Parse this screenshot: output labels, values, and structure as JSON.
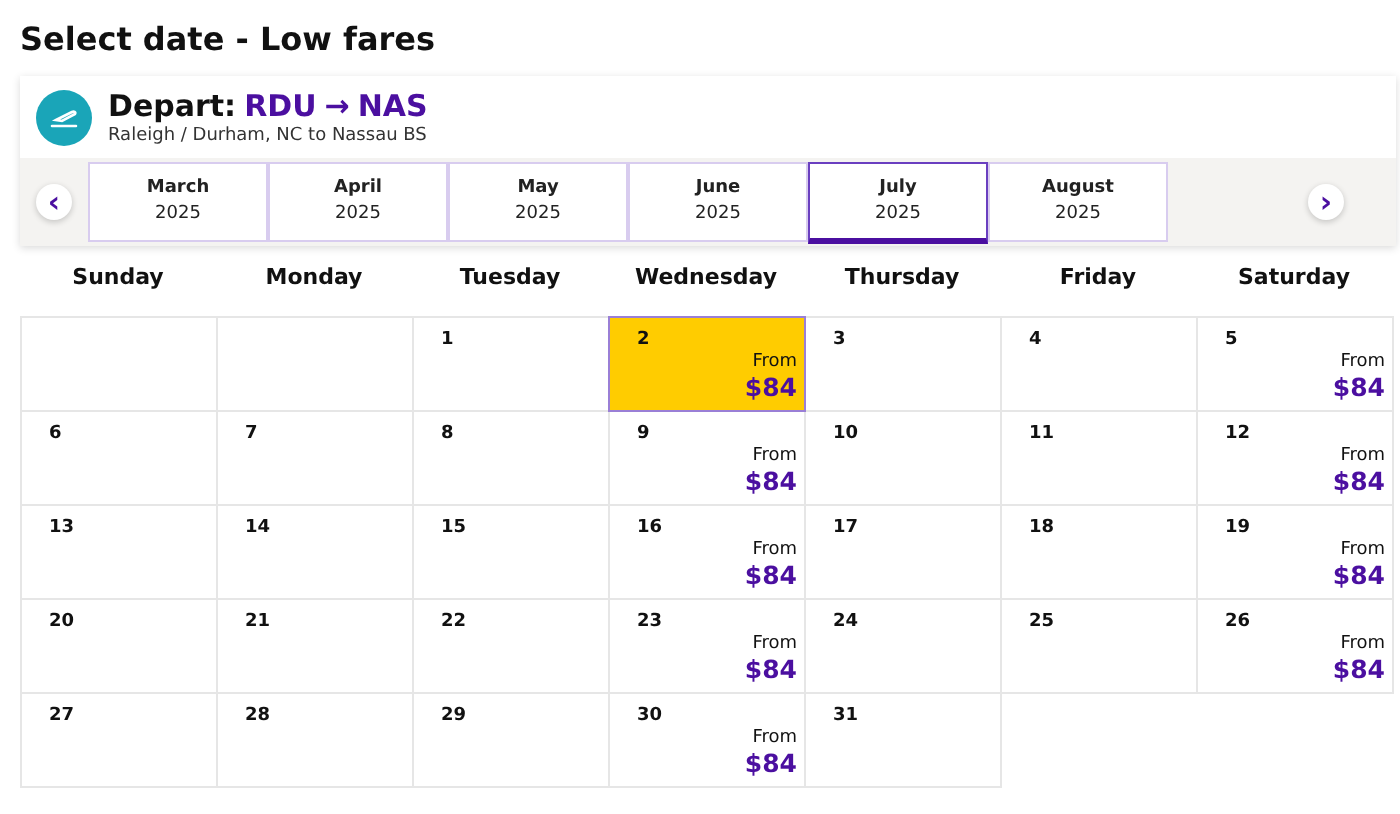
{
  "title": "Select date - Low fares",
  "route": {
    "label": "Depart:",
    "origin": "RDU",
    "arrow": "→",
    "destination": "NAS",
    "subtitle": "Raleigh / Durham, NC to Nassau BS"
  },
  "months": [
    {
      "month": "March",
      "year": "2025",
      "selected": false
    },
    {
      "month": "April",
      "year": "2025",
      "selected": false
    },
    {
      "month": "May",
      "year": "2025",
      "selected": false
    },
    {
      "month": "June",
      "year": "2025",
      "selected": false
    },
    {
      "month": "July",
      "year": "2025",
      "selected": true
    },
    {
      "month": "August",
      "year": "2025",
      "selected": false
    }
  ],
  "prev_button": "‹",
  "next_button": "›",
  "weekdays": [
    "Sunday",
    "Monday",
    "Tuesday",
    "Wednesday",
    "Thursday",
    "Friday",
    "Saturday"
  ],
  "weeks": [
    {
      "cells": [
        {
          "kind": "blank"
        },
        {
          "kind": "blank"
        },
        {
          "kind": "day",
          "day": "1",
          "selected": false
        },
        {
          "kind": "day",
          "day": "2",
          "from": "From",
          "fare": "$84",
          "selected": true
        },
        {
          "kind": "day",
          "day": "3",
          "selected": false
        },
        {
          "kind": "day",
          "day": "4",
          "selected": false
        },
        {
          "kind": "day",
          "day": "5",
          "from": "From",
          "fare": "$84",
          "selected": false
        }
      ]
    },
    {
      "cells": [
        {
          "kind": "day",
          "day": "6",
          "selected": false
        },
        {
          "kind": "day",
          "day": "7",
          "selected": false
        },
        {
          "kind": "day",
          "day": "8",
          "selected": false
        },
        {
          "kind": "day",
          "day": "9",
          "from": "From",
          "fare": "$84",
          "selected": false
        },
        {
          "kind": "day",
          "day": "10",
          "selected": false
        },
        {
          "kind": "day",
          "day": "11",
          "selected": false
        },
        {
          "kind": "day",
          "day": "12",
          "from": "From",
          "fare": "$84",
          "selected": false
        }
      ]
    },
    {
      "cells": [
        {
          "kind": "day",
          "day": "13",
          "selected": false
        },
        {
          "kind": "day",
          "day": "14",
          "selected": false
        },
        {
          "kind": "day",
          "day": "15",
          "selected": false
        },
        {
          "kind": "day",
          "day": "16",
          "from": "From",
          "fare": "$84",
          "selected": false
        },
        {
          "kind": "day",
          "day": "17",
          "selected": false
        },
        {
          "kind": "day",
          "day": "18",
          "selected": false
        },
        {
          "kind": "day",
          "day": "19",
          "from": "From",
          "fare": "$84",
          "selected": false
        }
      ]
    },
    {
      "cells": [
        {
          "kind": "day",
          "day": "20",
          "selected": false
        },
        {
          "kind": "day",
          "day": "21",
          "selected": false
        },
        {
          "kind": "day",
          "day": "22",
          "selected": false
        },
        {
          "kind": "day",
          "day": "23",
          "from": "From",
          "fare": "$84",
          "selected": false
        },
        {
          "kind": "day",
          "day": "24",
          "selected": false
        },
        {
          "kind": "day",
          "day": "25",
          "selected": false
        },
        {
          "kind": "day",
          "day": "26",
          "from": "From",
          "fare": "$84",
          "selected": false
        }
      ]
    },
    {
      "cells": [
        {
          "kind": "day",
          "day": "27",
          "selected": false
        },
        {
          "kind": "day",
          "day": "28",
          "selected": false
        },
        {
          "kind": "day",
          "day": "29",
          "selected": false
        },
        {
          "kind": "day",
          "day": "30",
          "from": "From",
          "fare": "$84",
          "selected": false
        },
        {
          "kind": "day",
          "day": "31",
          "selected": false
        }
      ]
    }
  ]
}
